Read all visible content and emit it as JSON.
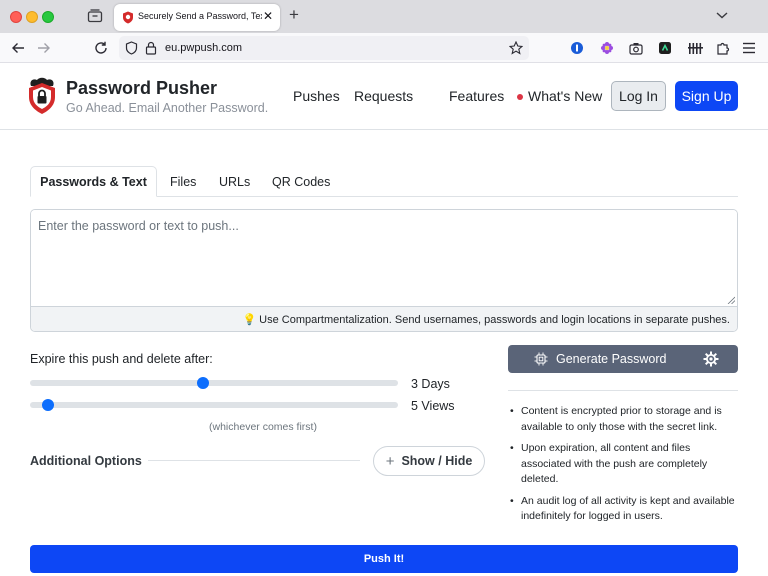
{
  "browser": {
    "tab_title": "Securely Send a Password, Text",
    "tab_close": "✕",
    "new_tab": "+",
    "url": "eu.pwpush.com"
  },
  "site": {
    "brand_title": "Password Pusher",
    "brand_subtitle": "Go Ahead. Email Another Password.",
    "nav": {
      "pushes": "Pushes",
      "requests": "Requests",
      "features": "Features",
      "whats_new": "What's New",
      "login": "Log In",
      "signup": "Sign Up"
    }
  },
  "form": {
    "tabs": [
      "Passwords & Text",
      "Files",
      "URLs",
      "QR Codes"
    ],
    "payload_placeholder": "Enter the password or text to push...",
    "tip": "Use Compartmentalization. Send usernames, passwords and login locations in separate pushes.",
    "expire_label": "Expire this push and delete after:",
    "days": {
      "label": "3 Days",
      "fraction": 0.47
    },
    "views": {
      "label": "5 Views",
      "fraction": 0.05
    },
    "whichever": "(whichever comes first)",
    "additional_options": "Additional Options",
    "show_hide": "Show / Hide",
    "push_button": "Push It!"
  },
  "sidebar": {
    "generate_password": "Generate Password",
    "info": [
      "Content is encrypted prior to storage and is available to only those with the secret link.",
      "Upon expiration, all content and files associated with the push are completely deleted.",
      "An audit log of all activity is kept and available indefinitely for logged in users."
    ]
  },
  "colors": {
    "primary": "#0d47f5",
    "generate_bg": "#5a6478",
    "slider_thumb": "#0d6efd",
    "whats_new_dot": "#dc3545"
  }
}
